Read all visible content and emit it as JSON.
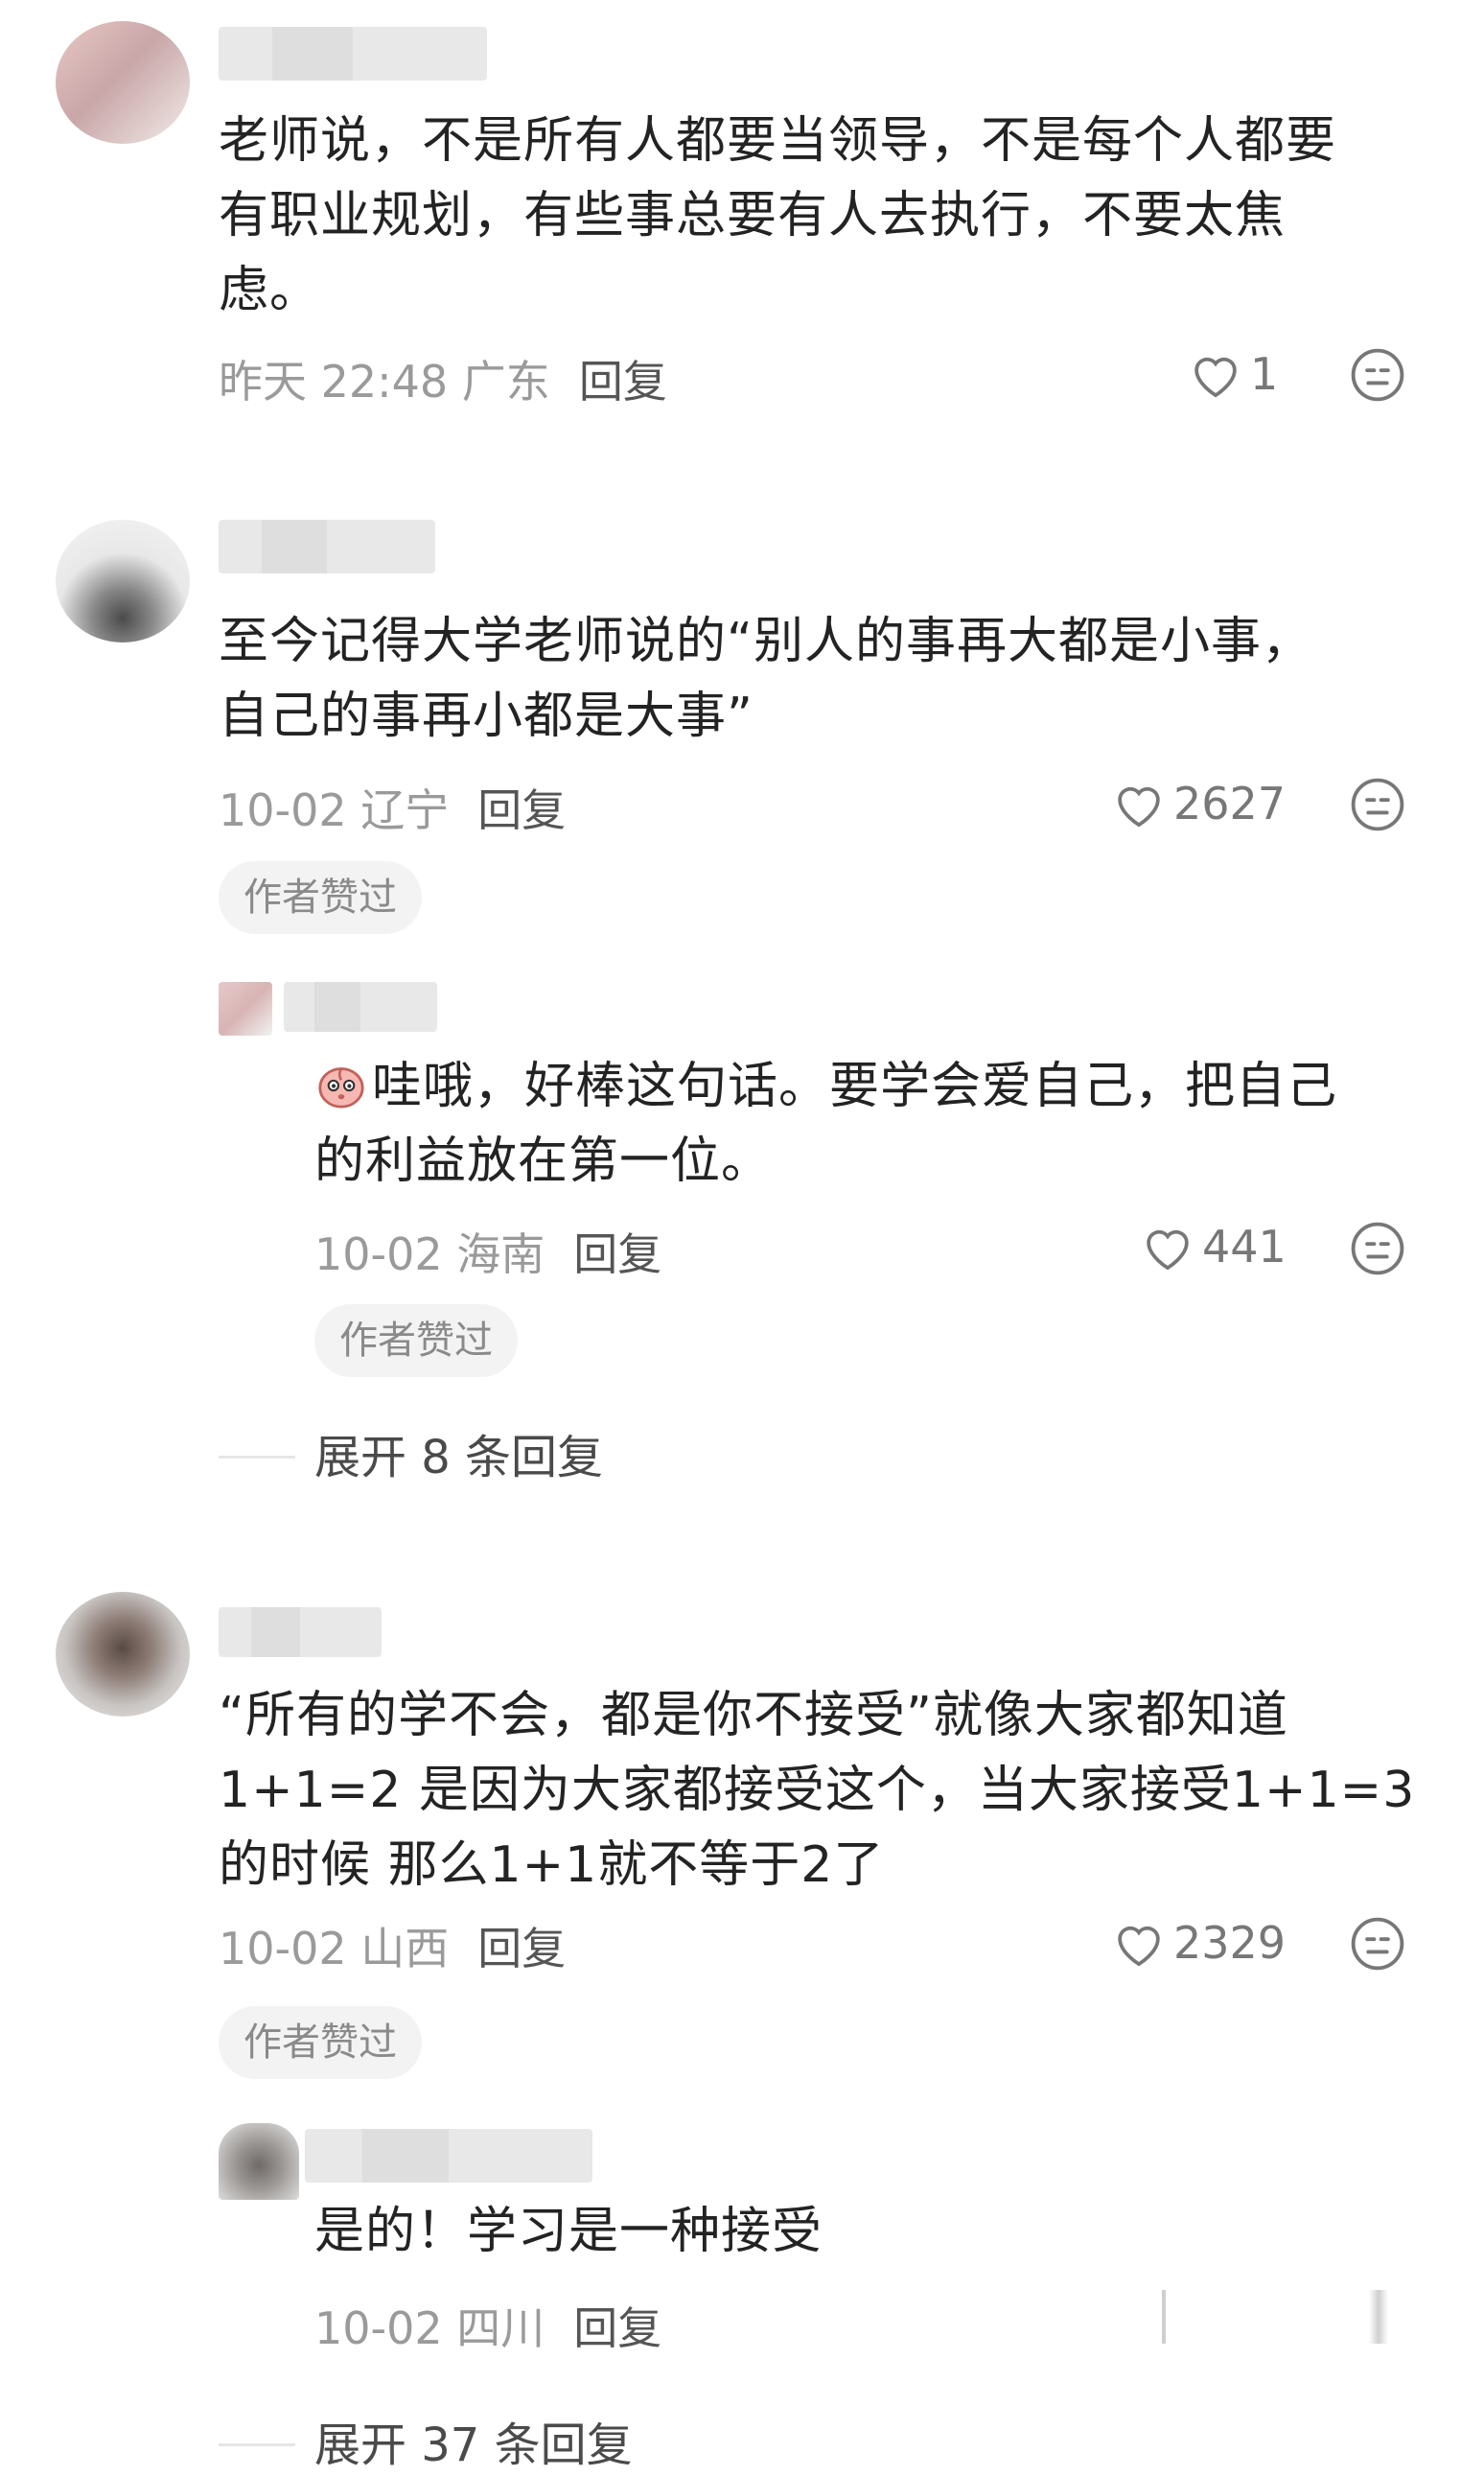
{
  "comments": [
    {
      "text_lines": [
        "老师说，不是所有人都要当领导，不是每个人都要",
        "有职业规划，有些事总要有人去执行，不要太焦",
        "虑。"
      ],
      "time_location": "昨天 22:48 广东",
      "reply_label": "回复",
      "likes": "1"
    },
    {
      "text_lines": [
        "至今记得大学老师说的“别人的事再大都是小事，",
        "自己的事再小都是大事”"
      ],
      "time_location": "10-02 辽宁",
      "reply_label": "回复",
      "likes": "2627",
      "badge": "作者赞过",
      "reply": {
        "text_lines": [
          "哇哦，好棒这句话。要学会爱自己，把自己",
          "的利益放在第一位。"
        ],
        "time_location": "10-02 海南",
        "reply_label": "回复",
        "likes": "441",
        "badge": "作者赞过"
      },
      "expand_label": "展开 8 条回复"
    },
    {
      "text_lines": [
        "“所有的学不会，都是你不接受”就像大家都知道",
        "1+1=2 是因为大家都接受这个，当大家接受1+1=3",
        "的时候 那么1+1就不等于2了"
      ],
      "time_location": "10-02 山西",
      "reply_label": "回复",
      "likes": "2329",
      "badge": "作者赞过",
      "reply": {
        "text_lines": [
          "是的！学习是一种接受"
        ],
        "time_location": "10-02 四川",
        "reply_label": "回复"
      },
      "expand_label": "展开 37 条回复"
    }
  ],
  "icons": {
    "like": "heart-outline-icon",
    "dislike": "neutral-face-icon",
    "reply_emoji": "peach-face-emoji-icon"
  },
  "colors": {
    "text": "#232323",
    "meta": "#9a9a9a",
    "badge_bg": "#f3f3f3"
  }
}
